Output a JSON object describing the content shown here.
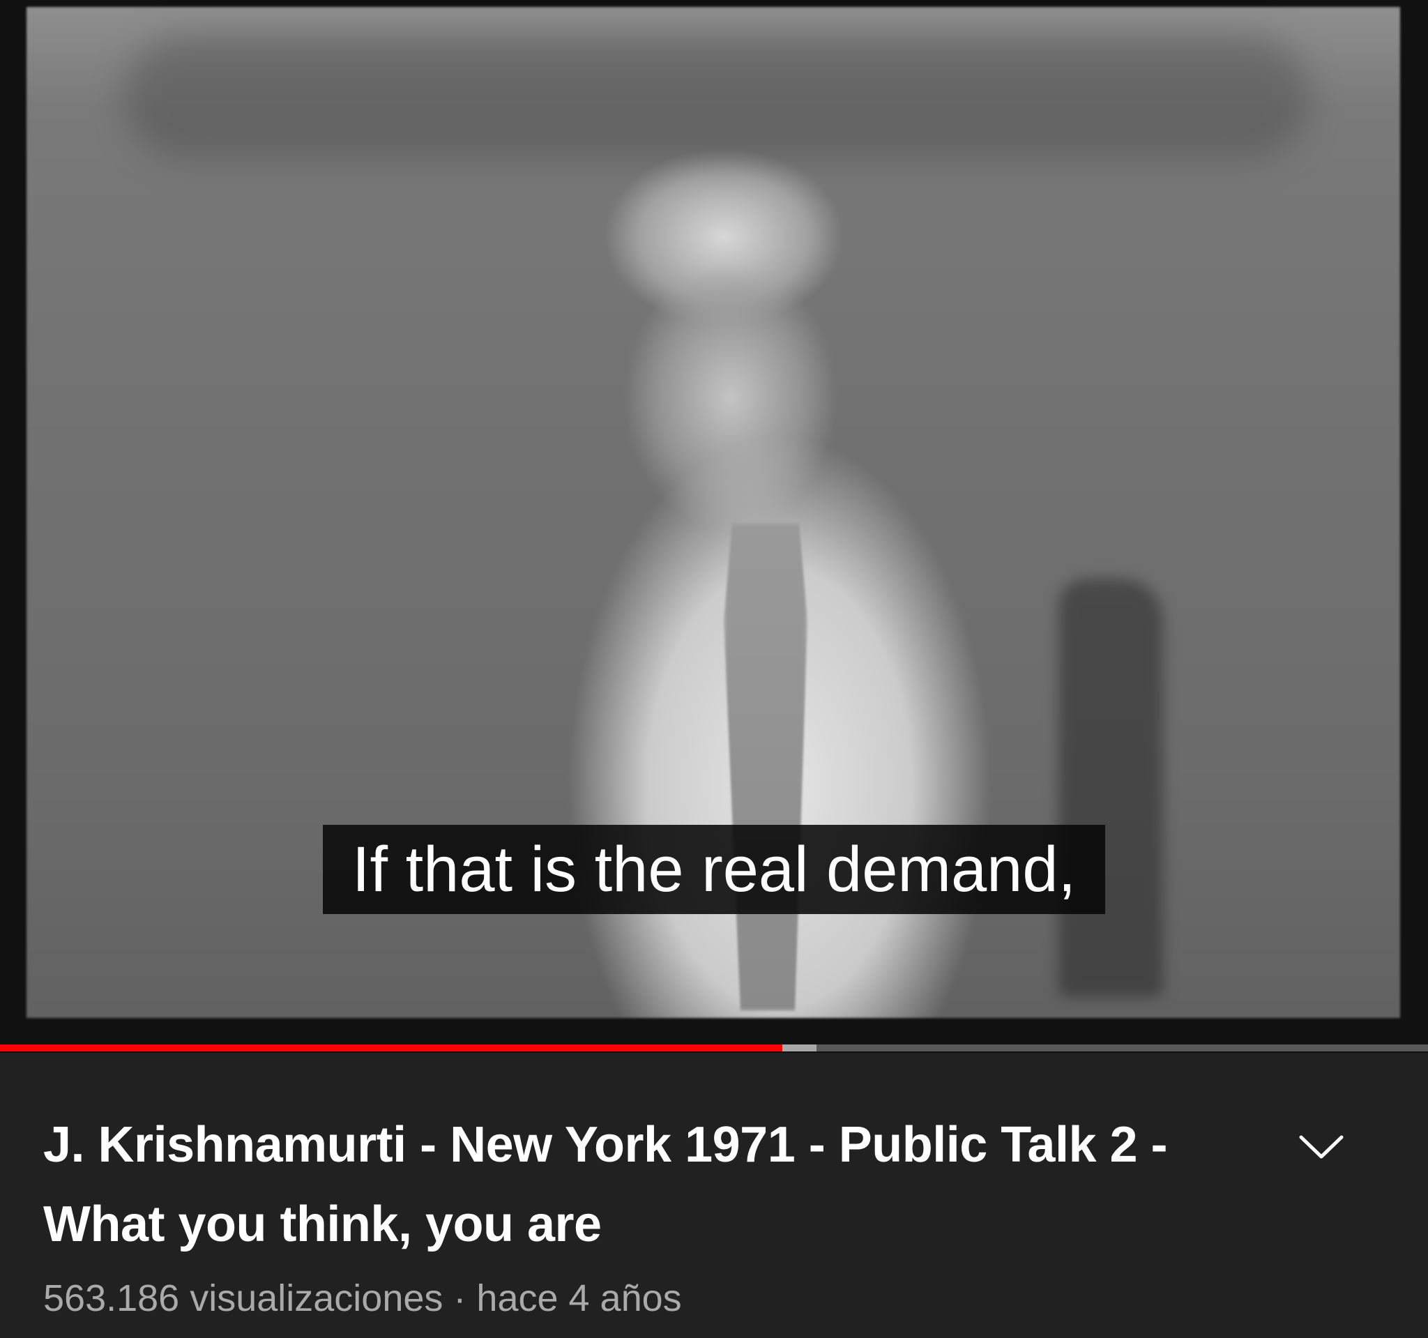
{
  "player": {
    "caption": "If that is the real demand,",
    "progress_played_fraction": 0.548,
    "progress_buffered_fraction": 0.572,
    "colors": {
      "played": "#ff0000",
      "buffered": "#a8a8a8",
      "track": "#5a5a5a"
    }
  },
  "video": {
    "title_line1": "J. Krishnamurti - New York 1971 - Public Talk 2 -",
    "title_line2": "What you think, you are",
    "views": "563.186 visualizaciones",
    "separator": "·",
    "age": "hace 4 años",
    "expand_icon": "chevron-down-icon"
  },
  "theme": {
    "background": "#212121",
    "text_primary": "#ffffff",
    "text_secondary": "#aaaaaa"
  }
}
